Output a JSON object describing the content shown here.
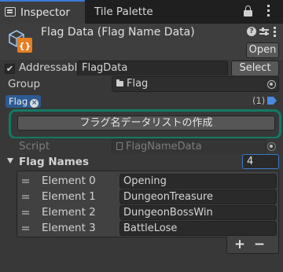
{
  "tabs": {
    "inspector": "Inspector",
    "tile_palette": "Tile Palette",
    "icons": [
      "inspector-icon",
      "lock-icon",
      "kebab-menu-icon"
    ]
  },
  "header": {
    "title": "Flag Data (Flag Name Data)",
    "open_label": "Open",
    "icons": [
      "scriptable-object-icon",
      "help-icon",
      "preset-sliders-icon",
      "kebab-menu-icon"
    ],
    "accent": "#e67e22"
  },
  "addressable": {
    "label": "Addressable",
    "checked": true,
    "address": "FlagData",
    "select_label": "Select"
  },
  "group": {
    "label": "Group",
    "value": "Flag"
  },
  "labels": {
    "chip": "Flag",
    "count": "(1)",
    "chip_color": "#2d5b91"
  },
  "create_button": {
    "label": "フラグ名データリストの作成",
    "highlight_color": "#127a63"
  },
  "script": {
    "label": "Script",
    "value": "FlagNameData"
  },
  "flag_names": {
    "label": "Flag Names",
    "size": "4",
    "elements": [
      {
        "label": "Element 0",
        "value": "Opening"
      },
      {
        "label": "Element 1",
        "value": "DungeonTreasure"
      },
      {
        "label": "Element 2",
        "value": "DungeonBossWin"
      },
      {
        "label": "Element 3",
        "value": "BattleLose"
      }
    ],
    "add_label": "+",
    "remove_label": "−"
  }
}
